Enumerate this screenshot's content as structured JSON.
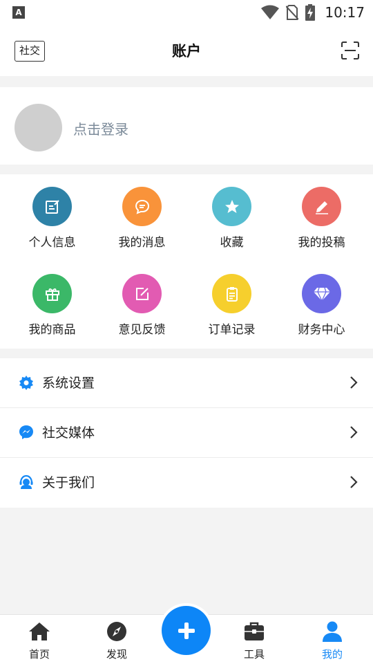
{
  "status_bar": {
    "left_badge": "A",
    "time": "10:17",
    "icons": [
      "wifi-icon",
      "no-sim-icon",
      "battery-charging-icon"
    ]
  },
  "header": {
    "social_button": "社交",
    "title": "账户",
    "scan_icon": "scan-icon"
  },
  "login": {
    "prompt": "点击登录"
  },
  "grid": {
    "items": [
      {
        "label": "个人信息",
        "icon": "edit-profile-icon",
        "color": "#2e82a7"
      },
      {
        "label": "我的消息",
        "icon": "message-icon",
        "color": "#f9933a"
      },
      {
        "label": "收藏",
        "icon": "star-icon",
        "color": "#56bdd0"
      },
      {
        "label": "我的投稿",
        "icon": "pencil-icon",
        "color": "#ec6c66"
      },
      {
        "label": "我的商品",
        "icon": "gift-icon",
        "color": "#3bb868"
      },
      {
        "label": "意见反馈",
        "icon": "feedback-icon",
        "color": "#e25bb2"
      },
      {
        "label": "订单记录",
        "icon": "clipboard-icon",
        "color": "#f6cf2d"
      },
      {
        "label": "财务中心",
        "icon": "diamond-icon",
        "color": "#6b69e6"
      }
    ]
  },
  "menu": {
    "items": [
      {
        "label": "系统设置",
        "icon": "gear-icon"
      },
      {
        "label": "社交媒体",
        "icon": "messenger-icon"
      },
      {
        "label": "关于我们",
        "icon": "headset-icon"
      }
    ]
  },
  "tabs": [
    {
      "label": "首页",
      "icon": "home-icon"
    },
    {
      "label": "发现",
      "icon": "compass-icon"
    },
    {
      "label": "工具",
      "icon": "toolbox-icon"
    },
    {
      "label": "我的",
      "icon": "user-icon",
      "active": true
    }
  ],
  "colors": {
    "accent": "#1789f5",
    "fab": "#0d86f7"
  }
}
